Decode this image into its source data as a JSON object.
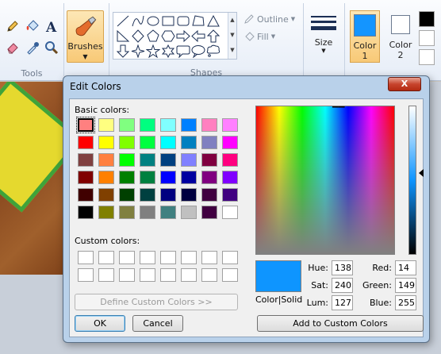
{
  "ribbon": {
    "tools_label": "Tools",
    "brushes_label": "Brushes",
    "shapes_label": "Shapes",
    "outline_label": "Outline",
    "fill_label": "Fill",
    "size_label": "Size",
    "color1_label_line1": "Color",
    "color1_label_line2": "1",
    "color2_label_line1": "Color",
    "color2_label_line2": "2",
    "color1_value": "#1495ff",
    "color2_value": "#ffffff",
    "accent": "#f8c977",
    "tool_icons": [
      "pencil-icon",
      "fill-bucket-icon",
      "text-icon",
      "eraser-icon",
      "color-picker-icon",
      "magnifier-icon"
    ],
    "shape_icons": [
      "line-shape-icon",
      "curve-shape-icon",
      "oval-shape-icon",
      "rectangle-shape-icon",
      "rounded-rectangle-shape-icon",
      "polygon-shape-icon",
      "triangle-shape-icon",
      "right-triangle-shape-icon",
      "diamond-shape-icon",
      "pentagon-shape-icon",
      "hexagon-shape-icon",
      "right-arrow-shape-icon",
      "left-arrow-shape-icon",
      "up-arrow-shape-icon",
      "down-arrow-shape-icon",
      "four-point-star-shape-icon",
      "five-point-star-shape-icon",
      "six-point-star-shape-icon",
      "rounded-callout-shape-icon",
      "oval-callout-shape-icon",
      "cloud-callout-shape-icon"
    ]
  },
  "dialog": {
    "title": "Edit Colors",
    "close_symbol": "X",
    "basic_colors_label": "Basic colors:",
    "custom_colors_label": "Custom colors:",
    "define_custom_label": "Define Custom Colors >>",
    "ok_label": "OK",
    "cancel_label": "Cancel",
    "add_custom_label": "Add to Custom Colors",
    "color_solid_label": "Color|Solid",
    "current_color": "#0e95ff",
    "selected_basic_index": 0,
    "basic_colors": [
      "#ff8080",
      "#ffff80",
      "#80ff80",
      "#00ff80",
      "#80ffff",
      "#0080ff",
      "#ff80c0",
      "#ff80ff",
      "#ff0000",
      "#ffff00",
      "#80ff00",
      "#00ff40",
      "#00ffff",
      "#0080c0",
      "#8080c0",
      "#ff00ff",
      "#804040",
      "#ff8040",
      "#00ff00",
      "#008080",
      "#004080",
      "#8080ff",
      "#800040",
      "#ff0080",
      "#800000",
      "#ff8000",
      "#008000",
      "#008040",
      "#0000ff",
      "#0000a0",
      "#800080",
      "#8000ff",
      "#400000",
      "#804000",
      "#004000",
      "#004040",
      "#000080",
      "#000040",
      "#400040",
      "#400080",
      "#000000",
      "#808000",
      "#808040",
      "#808080",
      "#408080",
      "#c0c0c0",
      "#400040",
      "#ffffff"
    ],
    "fields": {
      "hue_label": "Hue:",
      "hue": "138",
      "sat_label": "Sat:",
      "sat": "240",
      "lum_label": "Lum:",
      "lum": "127",
      "red_label": "Red:",
      "red": "14",
      "green_label": "Green:",
      "green": "149",
      "blue_label": "Blue:",
      "blue": "255"
    }
  }
}
